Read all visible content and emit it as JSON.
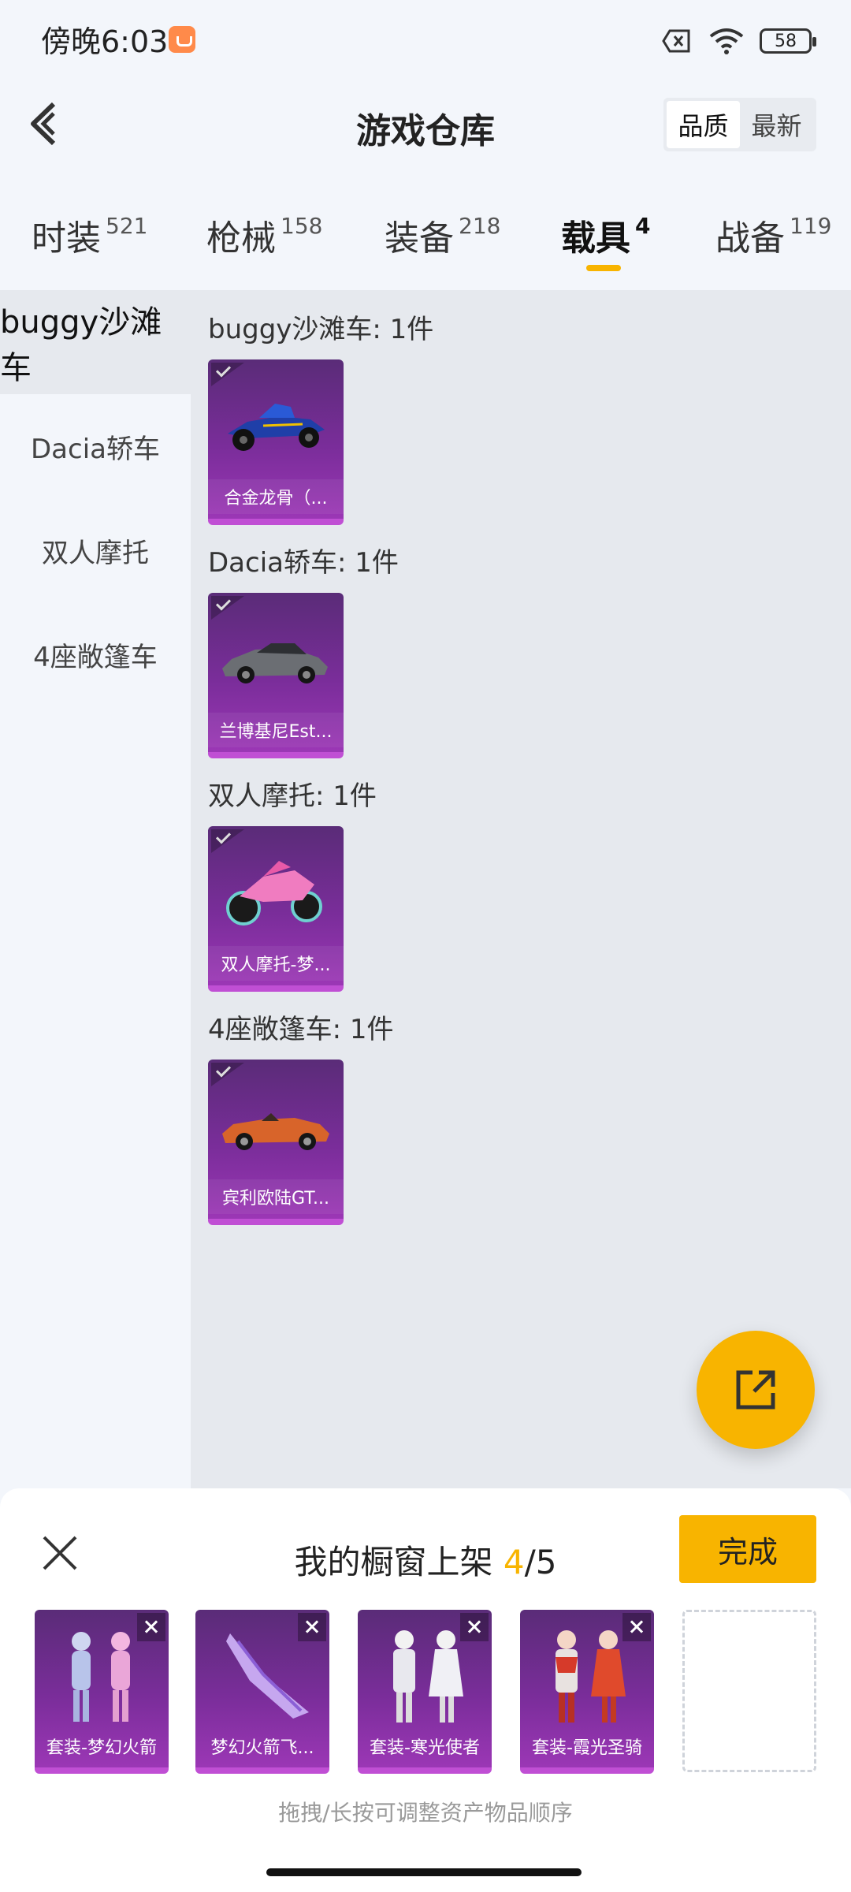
{
  "status_bar": {
    "time": "傍晚6:03",
    "battery": "58"
  },
  "header": {
    "title": "游戏仓库",
    "sort_options": [
      "品质",
      "最新"
    ]
  },
  "tabs": [
    {
      "label": "时装",
      "count": "521"
    },
    {
      "label": "枪械",
      "count": "158"
    },
    {
      "label": "装备",
      "count": "218"
    },
    {
      "label": "载具",
      "count": "4"
    },
    {
      "label": "战备",
      "count": "119"
    }
  ],
  "categories": [
    "buggy沙滩车",
    "Dacia轿车",
    "双人摩托",
    "4座敞篷车"
  ],
  "sections": [
    {
      "title": "buggy沙滩车: 1件",
      "item_label": "合金龙骨（..."
    },
    {
      "title": "Dacia轿车: 1件",
      "item_label": "兰博基尼Est..."
    },
    {
      "title": "双人摩托: 1件",
      "item_label": "双人摩托-梦..."
    },
    {
      "title": "4座敞篷车: 1件",
      "item_label": "宾利欧陆GT..."
    }
  ],
  "showcase": {
    "title_prefix": "我的橱窗上架 ",
    "current": "4",
    "total": "/5",
    "done_label": "完成",
    "items": [
      "套装-梦幻火箭",
      "梦幻火箭飞...",
      "套装-寒光使者",
      "套装-霞光圣骑"
    ],
    "hint": "拖拽/长按可调整资产物品顺序"
  },
  "colors": {
    "accent": "#f8b400",
    "card_purple": "#7a2d9a"
  }
}
